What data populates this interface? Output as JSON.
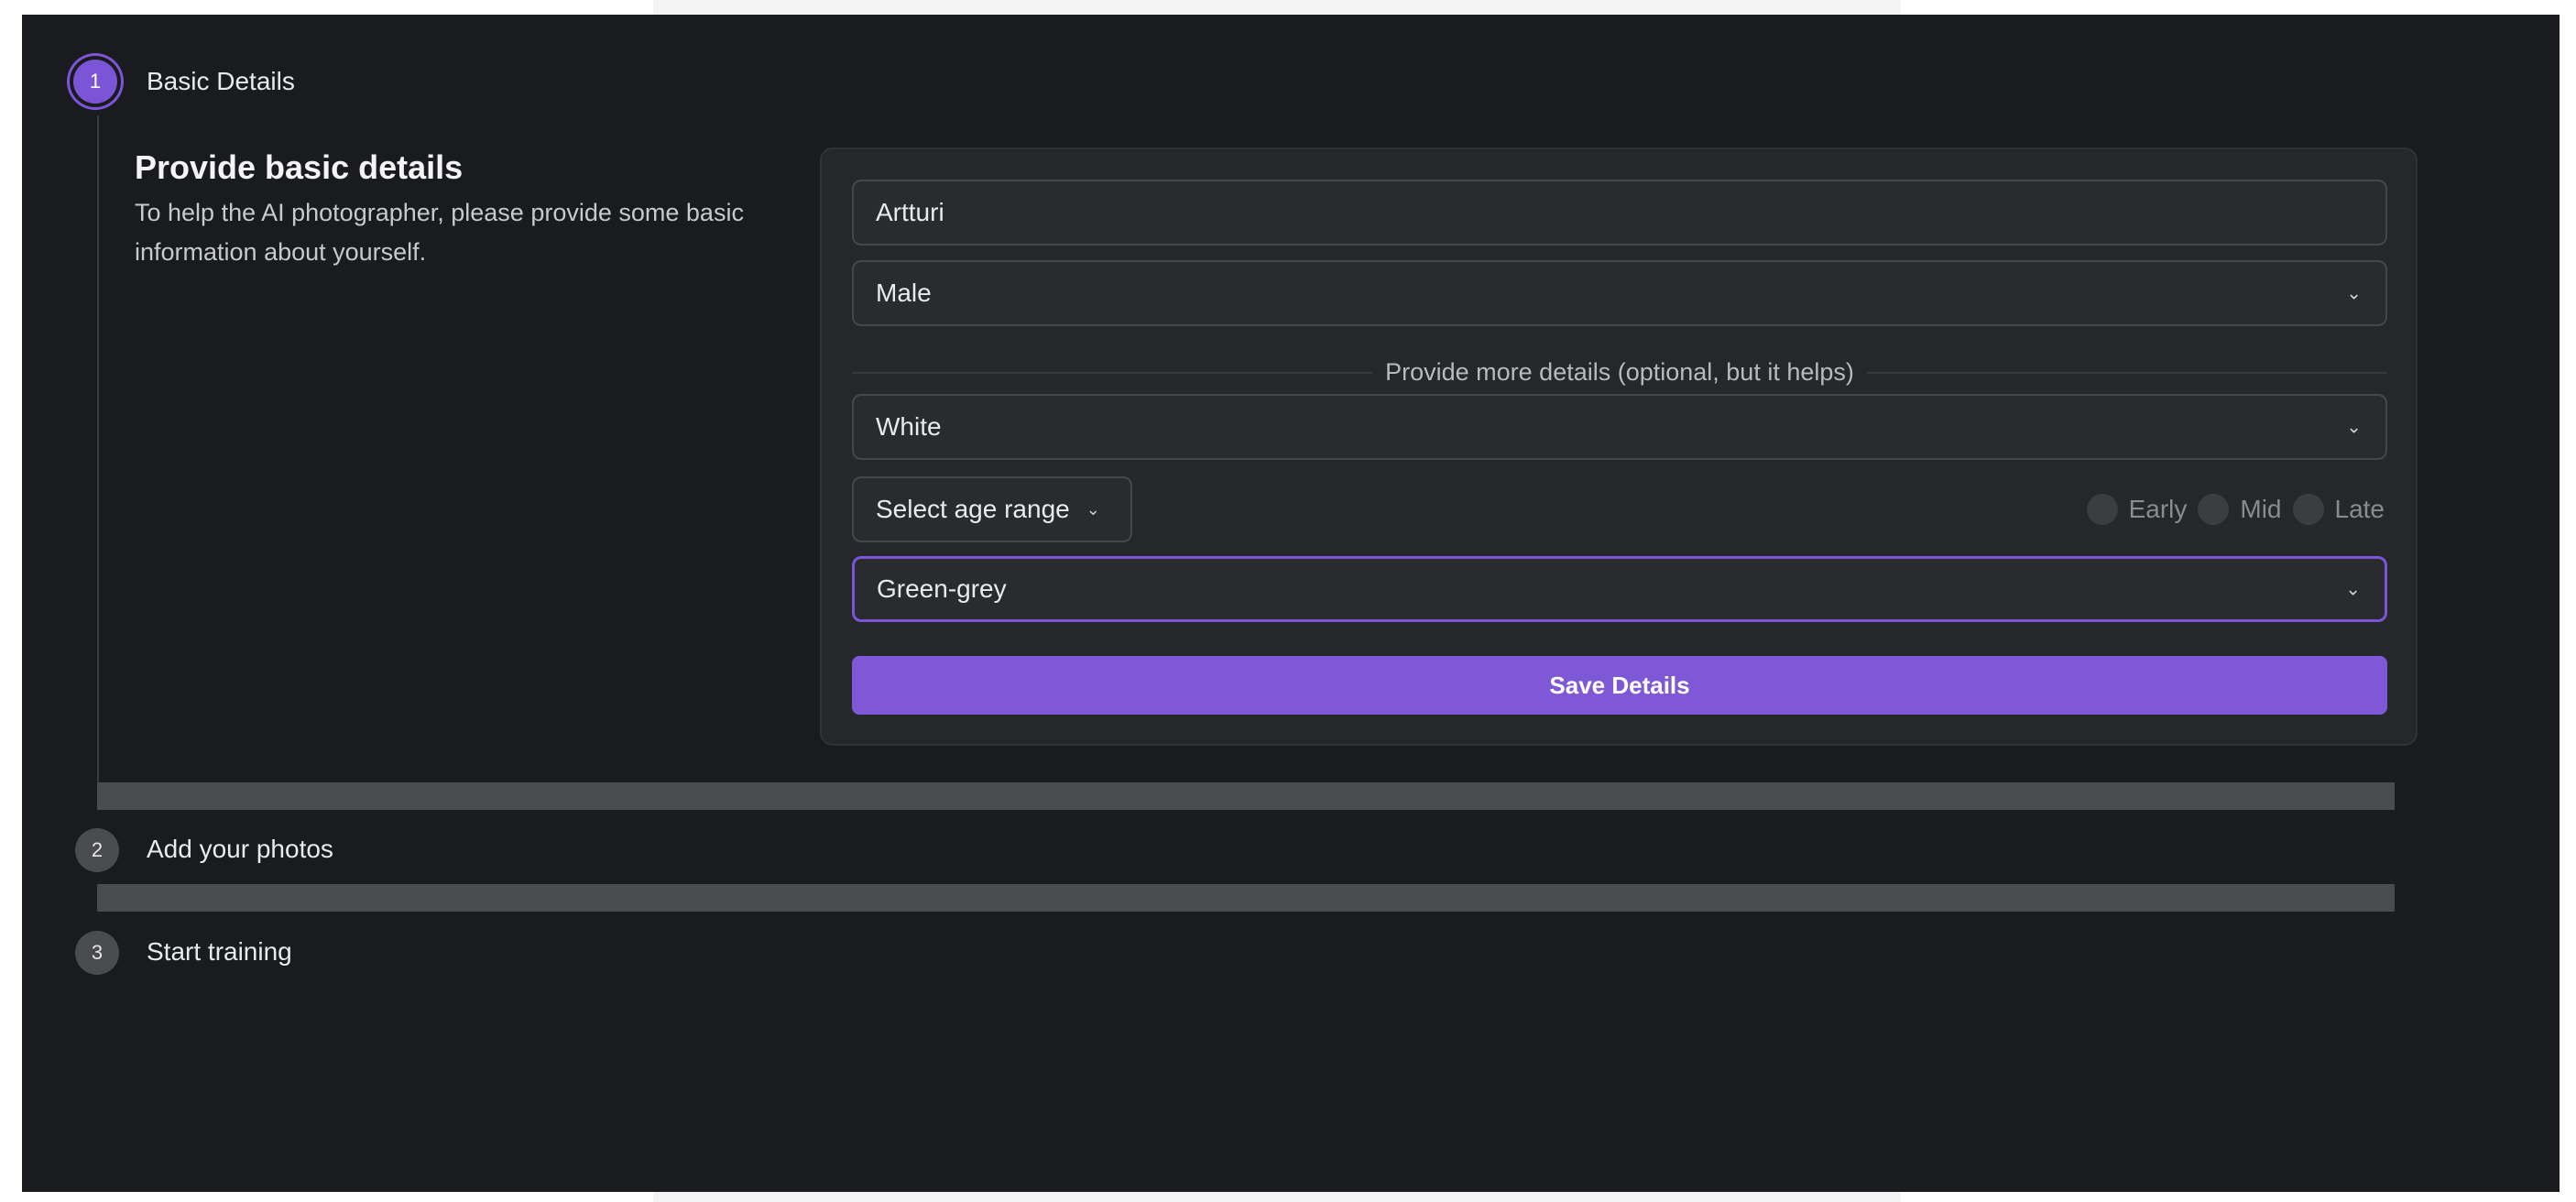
{
  "steps": [
    {
      "number": "1",
      "label": "Basic Details"
    },
    {
      "number": "2",
      "label": "Add your photos"
    },
    {
      "number": "3",
      "label": "Start training"
    }
  ],
  "section": {
    "title": "Provide basic details",
    "description": "To help the AI photographer, please provide some basic information about yourself."
  },
  "form": {
    "name_value": "Artturi",
    "gender_value": "Male",
    "divider_text": "Provide more details (optional, but it helps)",
    "ethnicity_value": "White",
    "age_range_label": "Select age range",
    "age_stage_options": [
      "Early",
      "Mid",
      "Late"
    ],
    "eye_color_value": "Green-grey",
    "save_label": "Save Details"
  },
  "icons": {
    "select_chevron": "chevron-down-icon"
  },
  "colors": {
    "accent": "#7f58d8",
    "background": "#191b1f",
    "card": "#25272b"
  }
}
